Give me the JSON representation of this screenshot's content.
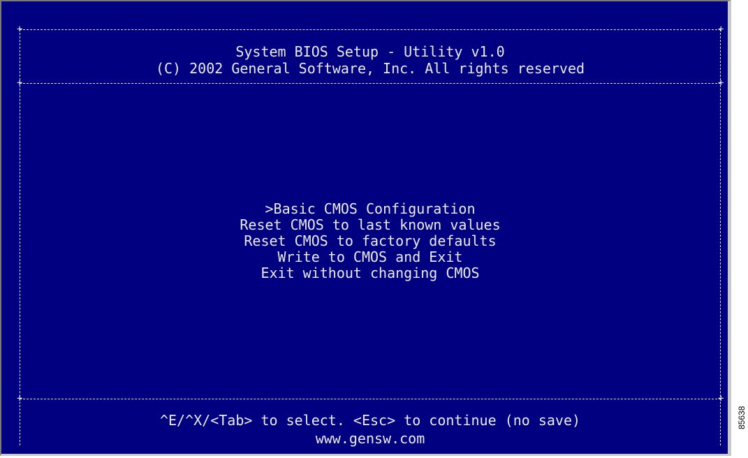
{
  "header": {
    "title": "System BIOS Setup - Utility v1.0",
    "copyright": "(C) 2002 General Software, Inc. All rights reserved"
  },
  "menu": {
    "selection_marker": ">",
    "items": [
      {
        "label": "Basic CMOS Configuration",
        "selected": true
      },
      {
        "label": "Reset CMOS to last known values",
        "selected": false
      },
      {
        "label": "Reset CMOS to factory defaults",
        "selected": false
      },
      {
        "label": "Write to CMOS and Exit",
        "selected": false
      },
      {
        "label": "Exit without changing CMOS",
        "selected": false
      }
    ]
  },
  "footer": {
    "help": "^E/^X/<Tab> to select. <Esc> to continue (no save)",
    "website": "www.gensw.com"
  },
  "figure_id": "85638",
  "colors": {
    "background": "#000080",
    "text": "#eaeaea"
  }
}
